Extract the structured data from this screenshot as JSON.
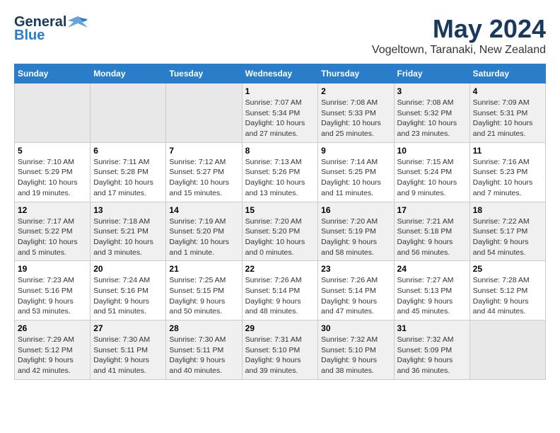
{
  "header": {
    "logo_general": "General",
    "logo_blue": "Blue",
    "month": "May 2024",
    "location": "Vogeltown, Taranaki, New Zealand"
  },
  "days_of_week": [
    "Sunday",
    "Monday",
    "Tuesday",
    "Wednesday",
    "Thursday",
    "Friday",
    "Saturday"
  ],
  "weeks": [
    [
      {
        "day": "",
        "empty": true
      },
      {
        "day": "",
        "empty": true
      },
      {
        "day": "",
        "empty": true
      },
      {
        "day": "1",
        "sunrise": "7:07 AM",
        "sunset": "5:34 PM",
        "daylight": "10 hours and 27 minutes."
      },
      {
        "day": "2",
        "sunrise": "7:08 AM",
        "sunset": "5:33 PM",
        "daylight": "10 hours and 25 minutes."
      },
      {
        "day": "3",
        "sunrise": "7:08 AM",
        "sunset": "5:32 PM",
        "daylight": "10 hours and 23 minutes."
      },
      {
        "day": "4",
        "sunrise": "7:09 AM",
        "sunset": "5:31 PM",
        "daylight": "10 hours and 21 minutes."
      }
    ],
    [
      {
        "day": "5",
        "sunrise": "7:10 AM",
        "sunset": "5:29 PM",
        "daylight": "10 hours and 19 minutes."
      },
      {
        "day": "6",
        "sunrise": "7:11 AM",
        "sunset": "5:28 PM",
        "daylight": "10 hours and 17 minutes."
      },
      {
        "day": "7",
        "sunrise": "7:12 AM",
        "sunset": "5:27 PM",
        "daylight": "10 hours and 15 minutes."
      },
      {
        "day": "8",
        "sunrise": "7:13 AM",
        "sunset": "5:26 PM",
        "daylight": "10 hours and 13 minutes."
      },
      {
        "day": "9",
        "sunrise": "7:14 AM",
        "sunset": "5:25 PM",
        "daylight": "10 hours and 11 minutes."
      },
      {
        "day": "10",
        "sunrise": "7:15 AM",
        "sunset": "5:24 PM",
        "daylight": "10 hours and 9 minutes."
      },
      {
        "day": "11",
        "sunrise": "7:16 AM",
        "sunset": "5:23 PM",
        "daylight": "10 hours and 7 minutes."
      }
    ],
    [
      {
        "day": "12",
        "sunrise": "7:17 AM",
        "sunset": "5:22 PM",
        "daylight": "10 hours and 5 minutes."
      },
      {
        "day": "13",
        "sunrise": "7:18 AM",
        "sunset": "5:21 PM",
        "daylight": "10 hours and 3 minutes."
      },
      {
        "day": "14",
        "sunrise": "7:19 AM",
        "sunset": "5:20 PM",
        "daylight": "10 hours and 1 minute."
      },
      {
        "day": "15",
        "sunrise": "7:20 AM",
        "sunset": "5:20 PM",
        "daylight": "10 hours and 0 minutes."
      },
      {
        "day": "16",
        "sunrise": "7:20 AM",
        "sunset": "5:19 PM",
        "daylight": "9 hours and 58 minutes."
      },
      {
        "day": "17",
        "sunrise": "7:21 AM",
        "sunset": "5:18 PM",
        "daylight": "9 hours and 56 minutes."
      },
      {
        "day": "18",
        "sunrise": "7:22 AM",
        "sunset": "5:17 PM",
        "daylight": "9 hours and 54 minutes."
      }
    ],
    [
      {
        "day": "19",
        "sunrise": "7:23 AM",
        "sunset": "5:16 PM",
        "daylight": "9 hours and 53 minutes."
      },
      {
        "day": "20",
        "sunrise": "7:24 AM",
        "sunset": "5:16 PM",
        "daylight": "9 hours and 51 minutes."
      },
      {
        "day": "21",
        "sunrise": "7:25 AM",
        "sunset": "5:15 PM",
        "daylight": "9 hours and 50 minutes."
      },
      {
        "day": "22",
        "sunrise": "7:26 AM",
        "sunset": "5:14 PM",
        "daylight": "9 hours and 48 minutes."
      },
      {
        "day": "23",
        "sunrise": "7:26 AM",
        "sunset": "5:14 PM",
        "daylight": "9 hours and 47 minutes."
      },
      {
        "day": "24",
        "sunrise": "7:27 AM",
        "sunset": "5:13 PM",
        "daylight": "9 hours and 45 minutes."
      },
      {
        "day": "25",
        "sunrise": "7:28 AM",
        "sunset": "5:12 PM",
        "daylight": "9 hours and 44 minutes."
      }
    ],
    [
      {
        "day": "26",
        "sunrise": "7:29 AM",
        "sunset": "5:12 PM",
        "daylight": "9 hours and 42 minutes."
      },
      {
        "day": "27",
        "sunrise": "7:30 AM",
        "sunset": "5:11 PM",
        "daylight": "9 hours and 41 minutes."
      },
      {
        "day": "28",
        "sunrise": "7:30 AM",
        "sunset": "5:11 PM",
        "daylight": "9 hours and 40 minutes."
      },
      {
        "day": "29",
        "sunrise": "7:31 AM",
        "sunset": "5:10 PM",
        "daylight": "9 hours and 39 minutes."
      },
      {
        "day": "30",
        "sunrise": "7:32 AM",
        "sunset": "5:10 PM",
        "daylight": "9 hours and 38 minutes."
      },
      {
        "day": "31",
        "sunrise": "7:32 AM",
        "sunset": "5:09 PM",
        "daylight": "9 hours and 36 minutes."
      },
      {
        "day": "",
        "empty": true
      }
    ]
  ]
}
